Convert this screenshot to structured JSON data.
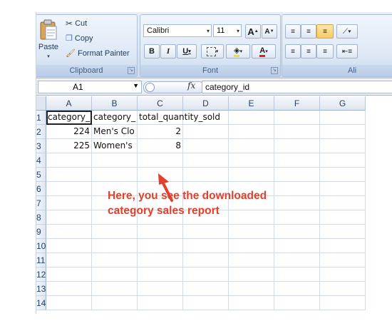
{
  "ribbon": {
    "clipboard": {
      "title": "Clipboard",
      "paste": "Paste",
      "cut": "Cut",
      "copy": "Copy",
      "format_painter": "Format Painter"
    },
    "font": {
      "title": "Font",
      "font_name": "Calibri",
      "font_size": "11",
      "bold": "B",
      "italic": "I",
      "underline": "U",
      "grow": "A",
      "shrink": "A",
      "font_color_letter": "A"
    },
    "alignment": {
      "title": "Ali"
    }
  },
  "formula_bar": {
    "name_box": "A1",
    "fx": "fx",
    "content": "category_id"
  },
  "grid": {
    "columns": [
      "A",
      "B",
      "C",
      "D",
      "E",
      "F",
      "G"
    ],
    "rows": [
      "1",
      "2",
      "3",
      "4",
      "5",
      "6",
      "7",
      "8",
      "9",
      "10",
      "11",
      "12",
      "13",
      "14"
    ],
    "cells": [
      [
        "category_",
        "category_",
        "total_quantity_sold",
        "",
        "",
        "",
        ""
      ],
      [
        "224",
        "Men's Clo",
        "2",
        "",
        "",
        "",
        ""
      ],
      [
        "225",
        "Women's",
        "8",
        "",
        "",
        "",
        ""
      ]
    ]
  },
  "annotation": {
    "line1": "Here, you see the downloaded",
    "line2": "category sales report",
    "color": "#e2402a"
  }
}
